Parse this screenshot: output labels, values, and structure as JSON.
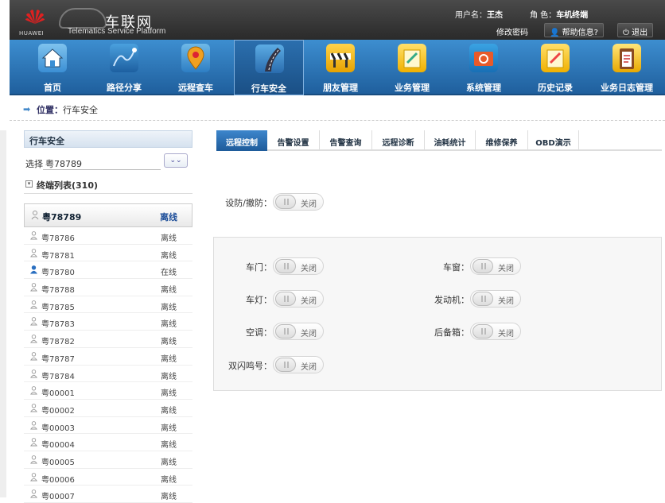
{
  "header": {
    "logo_text": "HUAWEI",
    "brand_cn": "车联网",
    "brand_en": "Telematics Service Platform",
    "user_label": "用户名：",
    "user_name": "王杰",
    "role_label": "角  色：",
    "role_name": "车机终端",
    "change_password": "修改密码",
    "help_label": "帮助信息?",
    "logout_label": "退出",
    "colors": {
      "header_bg": "#2f2f2f",
      "nav_bg": "#2f76ba"
    }
  },
  "nav": {
    "items": [
      {
        "label": "首页",
        "icon": "home-icon",
        "active": false
      },
      {
        "label": "路径分享",
        "icon": "route-map-icon",
        "active": false
      },
      {
        "label": "远程查车",
        "icon": "location-pin-icon",
        "active": false
      },
      {
        "label": "行车安全",
        "icon": "road-icon",
        "active": true
      },
      {
        "label": "朋友管理",
        "icon": "barrier-icon",
        "active": false
      },
      {
        "label": "业务管理",
        "icon": "business-icon",
        "active": false
      },
      {
        "label": "系统管理",
        "icon": "system-gear-icon",
        "active": false
      },
      {
        "label": "历史记录",
        "icon": "history-icon",
        "active": false
      },
      {
        "label": "业务日志管理",
        "icon": "log-clipboard-icon",
        "active": false
      }
    ]
  },
  "breadcrumb": {
    "prefix": "位置：",
    "current": "行车安全"
  },
  "sidebar": {
    "title": "行车安全",
    "select_label": "选择",
    "select_value": "粤78789",
    "tree_label": "终端列表(310)",
    "header": {
      "id": "粤78789",
      "status": "离线"
    },
    "rows": [
      {
        "id": "粤78786",
        "status": "离线",
        "online": false
      },
      {
        "id": "粤78781",
        "status": "离线",
        "online": false
      },
      {
        "id": "粤78780",
        "status": "在线",
        "online": true
      },
      {
        "id": "粤78788",
        "status": "离线",
        "online": false
      },
      {
        "id": "粤78785",
        "status": "离线",
        "online": false
      },
      {
        "id": "粤78783",
        "status": "离线",
        "online": false
      },
      {
        "id": "粤78782",
        "status": "离线",
        "online": false
      },
      {
        "id": "粤78787",
        "status": "离线",
        "online": false
      },
      {
        "id": "粤78784",
        "status": "离线",
        "online": false
      },
      {
        "id": "粤00001",
        "status": "离线",
        "online": false
      },
      {
        "id": "粤00002",
        "status": "离线",
        "online": false
      },
      {
        "id": "粤00003",
        "status": "离线",
        "online": false
      },
      {
        "id": "粤00004",
        "status": "离线",
        "online": false
      },
      {
        "id": "粤00005",
        "status": "离线",
        "online": false
      },
      {
        "id": "粤00006",
        "status": "离线",
        "online": false
      },
      {
        "id": "粤00007",
        "status": "离线",
        "online": false
      }
    ]
  },
  "tabs": [
    {
      "label": "远程控制",
      "active": true
    },
    {
      "label": "告警设置",
      "active": false
    },
    {
      "label": "告警查询",
      "active": false
    },
    {
      "label": "远程诊断",
      "active": false
    },
    {
      "label": "油耗统计",
      "active": false
    },
    {
      "label": "维修保养",
      "active": false
    },
    {
      "label": "OBD演示",
      "active": false
    }
  ],
  "controls": {
    "arm": {
      "label": "设防/撤防：",
      "state": "关闭"
    },
    "door": {
      "label": "车门：",
      "state": "关闭"
    },
    "window": {
      "label": "车窗：",
      "state": "关闭"
    },
    "light": {
      "label": "车灯：",
      "state": "关闭"
    },
    "engine": {
      "label": "发动机：",
      "state": "关闭"
    },
    "ac": {
      "label": "空调：",
      "state": "关闭"
    },
    "trunk": {
      "label": "后备箱：",
      "state": "关闭"
    },
    "flash_horn": {
      "label": "双闪鸣号：",
      "state": "关闭"
    }
  }
}
